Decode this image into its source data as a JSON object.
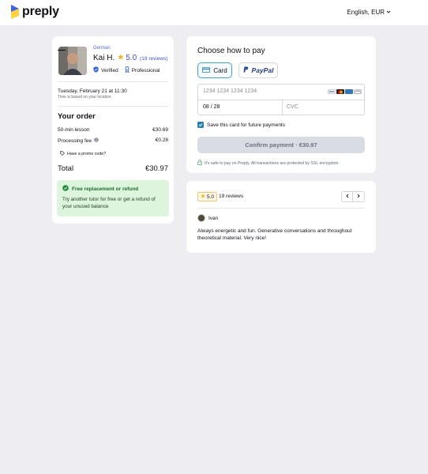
{
  "header": {
    "brand": "preply",
    "language_currency": "English, EUR"
  },
  "tutor": {
    "language": "German",
    "name": "Kai H.",
    "rating": "5.0",
    "reviews": "(19 reviews)",
    "verified_label": "Verified",
    "professional_label": "Professional"
  },
  "schedule": {
    "datetime": "Tuesday, February 21 at 11:30",
    "note": "Time is based on your location"
  },
  "order": {
    "title": "Your order",
    "items": [
      {
        "label": "50-min lesson",
        "amount": "€30.69"
      },
      {
        "label": "Processing fee",
        "amount": "€0.28"
      }
    ],
    "promo": "Have a promo code?",
    "total_label": "Total",
    "total_amount": "€30.97"
  },
  "guarantee": {
    "title": "Free replacement or refund",
    "text": "Try another tutor for free or get a refund of your unused balance"
  },
  "payment": {
    "title": "Choose how to pay",
    "method_card": "Card",
    "method_paypal": "PayPal",
    "card_number_placeholder": "1234 1234 1234 1234",
    "expiry_value": "08 / 28",
    "cvc_placeholder": "CVC",
    "save_label": "Save this card for future payments",
    "confirm_label": "Confirm payment · €30.97",
    "secure_note": "It's safe to pay on Preply. All transactions are protected by SSL encryption.",
    "card_brands": [
      "VISA",
      "MC",
      "AMEX",
      "CARD"
    ]
  },
  "reviews": {
    "rating": "5.0",
    "count_label": "19 reviews",
    "reviewer": "Ivan",
    "text": "Always energetic and fun. Generative conversations and throughout theoretical material. Very nice!"
  },
  "colors": {
    "accent_blue": "#3ea5cf",
    "rating_blue": "#3f51c8",
    "guarantee_bg": "#dcf5dc",
    "guarantee_text": "#1d6b2c",
    "star": "#f5b324"
  }
}
